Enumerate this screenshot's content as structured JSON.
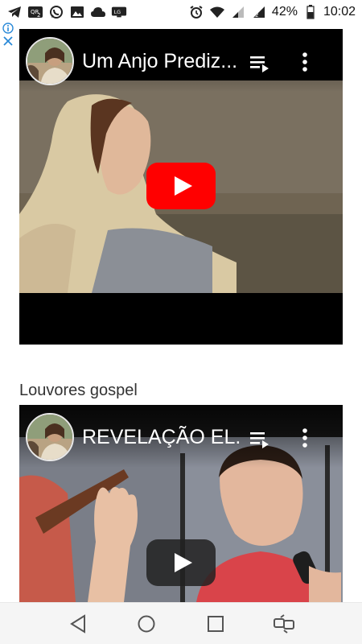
{
  "status_bar": {
    "battery_percent": "42%",
    "time": "10:02",
    "notification_icons": [
      "telegram-icon",
      "sim-2-icon",
      "whatsapp-icon",
      "gallery-icon",
      "cloud-icon",
      "lg-connect-icon"
    ],
    "system_icons": [
      "alarm-icon",
      "wifi-icon",
      "signal-1-icon",
      "signal-2-icon",
      "battery-icon"
    ]
  },
  "ad": {
    "info_icon": "info-icon",
    "close_icon": "close-icon"
  },
  "videos": [
    {
      "title": "Um Anjo Prediz...",
      "play_button_color": "#ff0000",
      "channel_avatar": "channel-avatar"
    },
    {
      "title": "REVELAÇÃO EL...",
      "play_button_color": "#212121",
      "channel_avatar": "channel-avatar"
    }
  ],
  "section": {
    "heading": "Louvores gospel"
  },
  "navbar": {
    "buttons": [
      "back-icon",
      "home-icon",
      "recents-icon",
      "switch-app-icon"
    ]
  }
}
